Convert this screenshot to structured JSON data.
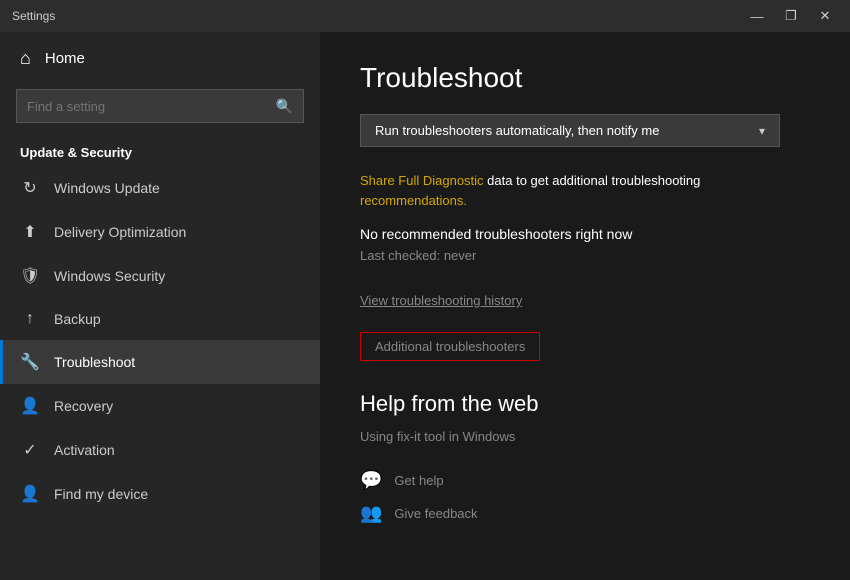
{
  "titleBar": {
    "title": "Settings",
    "minimize": "—",
    "maximize": "❐",
    "close": "✕"
  },
  "sidebar": {
    "home": "Home",
    "search_placeholder": "Find a setting",
    "section_title": "Update & Security",
    "items": [
      {
        "id": "windows-update",
        "label": "Windows Update",
        "icon": "↻"
      },
      {
        "id": "delivery-optimization",
        "label": "Delivery Optimization",
        "icon": "⬆"
      },
      {
        "id": "windows-security",
        "label": "Windows Security",
        "icon": "🛡"
      },
      {
        "id": "backup",
        "label": "Backup",
        "icon": "⬆"
      },
      {
        "id": "troubleshoot",
        "label": "Troubleshoot",
        "icon": "🔧",
        "active": true
      },
      {
        "id": "recovery",
        "label": "Recovery",
        "icon": "👤"
      },
      {
        "id": "activation",
        "label": "Activation",
        "icon": "✓"
      },
      {
        "id": "find-my-device",
        "label": "Find my device",
        "icon": "👤"
      }
    ]
  },
  "main": {
    "title": "Troubleshoot",
    "dropdown_label": "Run troubleshooters automatically, then notify me",
    "diagnostic_text": "Share Full Diagnostic data to get additional troubleshooting recommendations.",
    "diagnostic_link_text": "Share Full Diagnostic",
    "diagnostic_rest": " data to get additional troubleshooting",
    "diagnostic_rest2": "recommendations.",
    "no_recommended": "No recommended troubleshooters right now",
    "last_checked": "Last checked: never",
    "view_history": "View troubleshooting history",
    "additional_troubleshooters": "Additional troubleshooters",
    "help_title": "Help from the web",
    "help_desc": "Using fix-it tool in Windows",
    "help_items": [
      {
        "id": "get-help",
        "label": "Get help",
        "icon": "💬"
      },
      {
        "id": "give-feedback",
        "label": "Give feedback",
        "icon": "👥"
      }
    ]
  }
}
